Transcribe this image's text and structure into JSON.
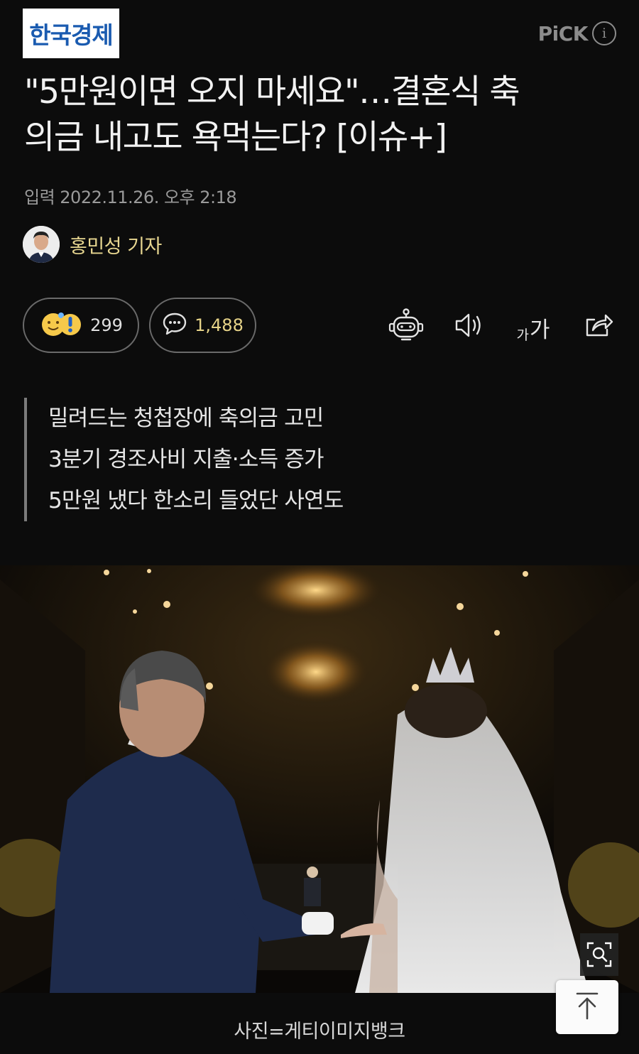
{
  "header": {
    "press_logo": "한국경제",
    "pick_label": "PiCK",
    "pick_info_icon": "info-icon"
  },
  "article": {
    "title_line1": "\"5만원이면 오지 마세요\"…결혼식 축",
    "title_line2": "의금 내고도 욕먹는다? [이슈+]",
    "dateline": "입력 2022.11.26. 오후 2:18",
    "author": "홍민성 기자"
  },
  "actions": {
    "reaction_count": "299",
    "comment_count": "1,488",
    "icons": [
      "reaction-emoji-icon",
      "comment-icon",
      "robot-summary-icon",
      "speaker-icon",
      "font-size-icon",
      "share-icon"
    ],
    "font_small": "가",
    "font_big": "가"
  },
  "summary": [
    "밀려드는 청첩장에 축의금 고민",
    "3분기 경조사비 지출·소득 증가",
    "5만원 냈다 한소리 들었단 사연도"
  ],
  "photo": {
    "caption": "사진=게티이미지뱅크",
    "zoom_icon": "zoom-search-icon"
  },
  "scroll_top_icon": "arrow-up-to-top-icon",
  "colors": {
    "background": "#0c0c0c",
    "author_accent": "#e7d690",
    "logo_blue": "#1a5bb0"
  }
}
